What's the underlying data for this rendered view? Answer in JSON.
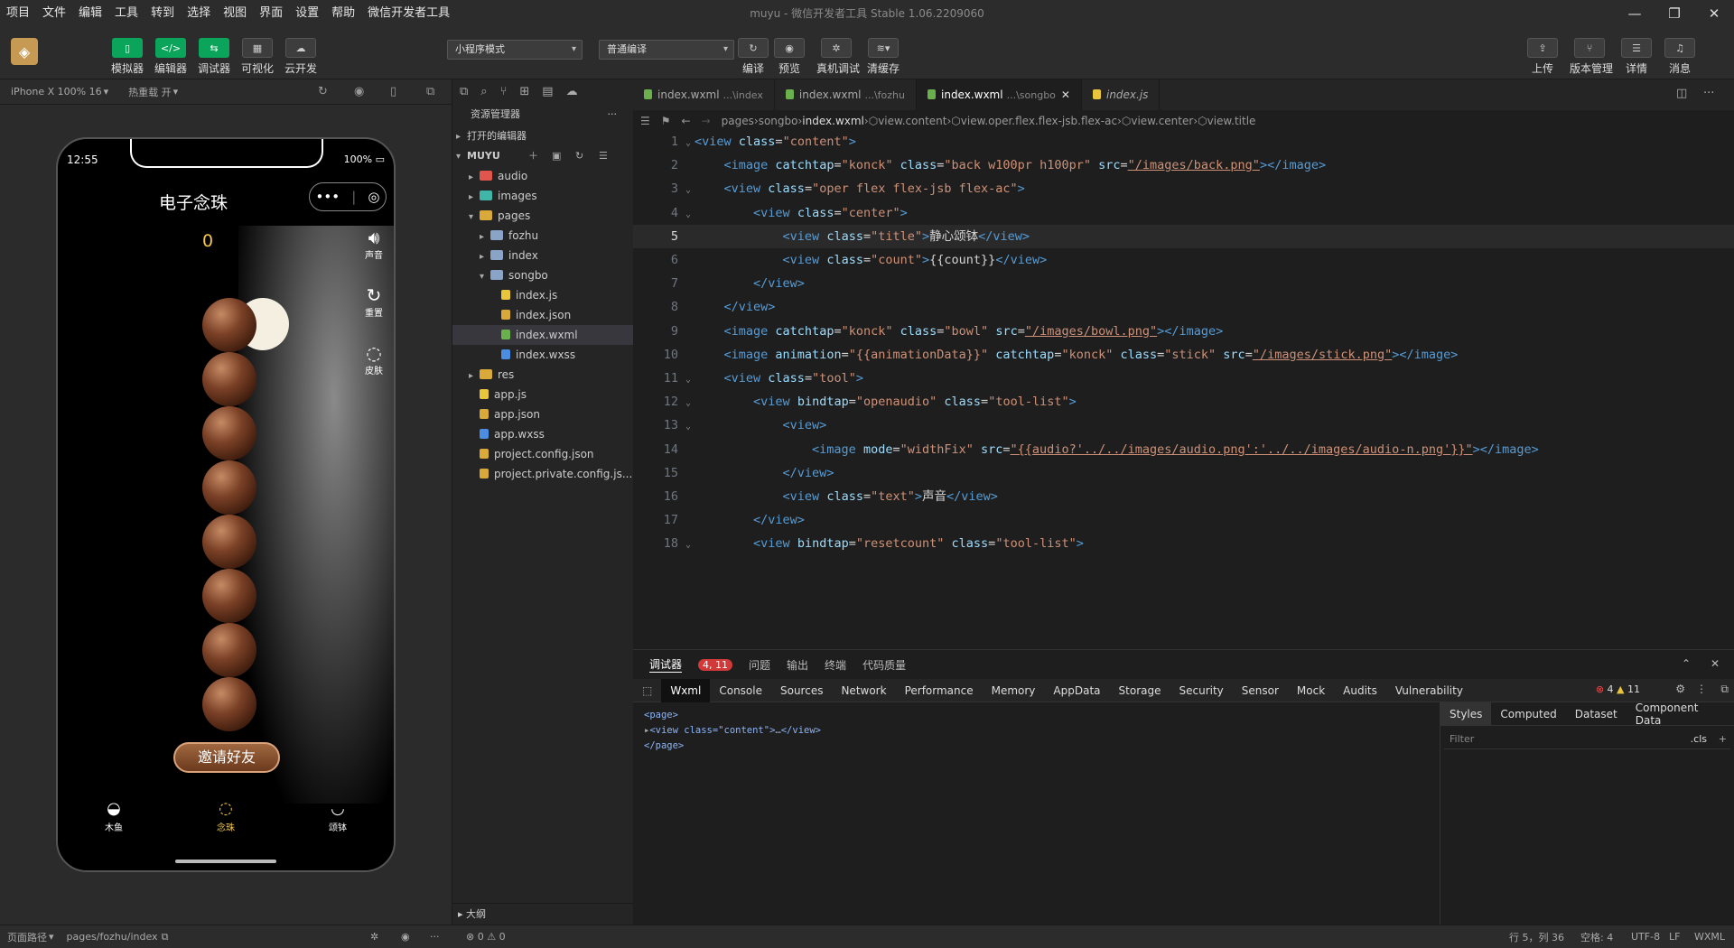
{
  "menu": [
    "项目",
    "文件",
    "编辑",
    "工具",
    "转到",
    "选择",
    "视图",
    "界面",
    "设置",
    "帮助",
    "微信开发者工具"
  ],
  "window_title": "muyu - 微信开发者工具 Stable 1.06.2209060",
  "toolbar": {
    "left_buttons": [
      "模拟器",
      "编辑器",
      "调试器",
      "可视化",
      "云开发"
    ],
    "mode_select": "小程序模式",
    "compile_select": "普通编译",
    "center_buttons": [
      "编译",
      "预览",
      "真机调试",
      "清缓存"
    ],
    "right_buttons": [
      "上传",
      "版本管理",
      "详情",
      "消息"
    ]
  },
  "simulator": {
    "device": "iPhone X 100% 16",
    "hot_reload": "热重载 开",
    "status_time": "12:55",
    "battery": "100%",
    "page_title": "电子念珠",
    "count": "0",
    "side_buttons": [
      "声音",
      "重置",
      "皮肤"
    ],
    "invite_label": "邀请好友",
    "tabbar": [
      "木鱼",
      "念珠",
      "颂钵"
    ],
    "tabbar_active": 1
  },
  "explorer": {
    "title": "资源管理器",
    "open_editors": "打开的编辑器",
    "project": "MUYU",
    "tree": [
      {
        "name": "audio",
        "type": "folder",
        "depth": 0,
        "color": "#e0564c"
      },
      {
        "name": "images",
        "type": "folder",
        "depth": 0,
        "color": "#3fb6a8"
      },
      {
        "name": "pages",
        "type": "folder-open",
        "depth": 0,
        "color": "#d9a93a"
      },
      {
        "name": "fozhu",
        "type": "folder",
        "depth": 1,
        "color": "#8aa4c8"
      },
      {
        "name": "index",
        "type": "folder",
        "depth": 1,
        "color": "#8aa4c8"
      },
      {
        "name": "songbo",
        "type": "folder-open",
        "depth": 1,
        "color": "#8aa4c8"
      },
      {
        "name": "index.js",
        "type": "js",
        "depth": 2,
        "color": "#e8c53a"
      },
      {
        "name": "index.json",
        "type": "json",
        "depth": 2,
        "color": "#d9a93a"
      },
      {
        "name": "index.wxml",
        "type": "wxml",
        "depth": 2,
        "color": "#6ab04c",
        "selected": true
      },
      {
        "name": "index.wxss",
        "type": "wxss",
        "depth": 2,
        "color": "#4b8de0"
      },
      {
        "name": "res",
        "type": "folder",
        "depth": 0,
        "color": "#d9a93a"
      },
      {
        "name": "app.js",
        "type": "js",
        "depth": 0,
        "color": "#e8c53a"
      },
      {
        "name": "app.json",
        "type": "json",
        "depth": 0,
        "color": "#d9a93a"
      },
      {
        "name": "app.wxss",
        "type": "wxss",
        "depth": 0,
        "color": "#4b8de0"
      },
      {
        "name": "project.config.json",
        "type": "json",
        "depth": 0,
        "color": "#d9a93a"
      },
      {
        "name": "project.private.config.js...",
        "type": "json",
        "depth": 0,
        "color": "#d9a93a"
      }
    ],
    "outline": "大纲"
  },
  "editor": {
    "tabs": [
      {
        "name": "index.wxml",
        "path": "...\\index",
        "active": false
      },
      {
        "name": "index.wxml",
        "path": "...\\fozhu",
        "active": false
      },
      {
        "name": "index.wxml",
        "path": "...\\songbo",
        "active": true
      },
      {
        "name": "index.js",
        "path": "",
        "active": false
      }
    ],
    "breadcrumb": [
      "pages",
      "songbo",
      "index.wxml",
      "view.content",
      "view.oper.flex.flex-jsb.flex-ac",
      "view.center",
      "view.title"
    ],
    "lines": [
      {
        "n": "1",
        "fold": true,
        "tokens": [
          [
            "#569cd6",
            "<view "
          ],
          [
            "#9cdcfe",
            "class"
          ],
          [
            "#d4d4d4",
            "="
          ],
          [
            "#ce9178",
            "\"content\""
          ],
          [
            "#569cd6",
            ">"
          ]
        ]
      },
      {
        "n": "2",
        "fold": false,
        "tokens": [
          [
            "#d4d4d4",
            "    "
          ],
          [
            "#569cd6",
            "<image "
          ],
          [
            "#9cdcfe",
            "catchtap"
          ],
          [
            "#d4d4d4",
            "="
          ],
          [
            "#ce9178",
            "\"konck\" "
          ],
          [
            "#9cdcfe",
            "class"
          ],
          [
            "#d4d4d4",
            "="
          ],
          [
            "#ce9178",
            "\"back w100pr h100pr\" "
          ],
          [
            "#9cdcfe",
            "src"
          ],
          [
            "#d4d4d4",
            "="
          ],
          [
            "#ce9178",
            "\"/images/back.png\""
          ],
          [
            "#569cd6",
            "></image>"
          ]
        ]
      },
      {
        "n": "3",
        "fold": true,
        "tokens": [
          [
            "#d4d4d4",
            "    "
          ],
          [
            "#569cd6",
            "<view "
          ],
          [
            "#9cdcfe",
            "class"
          ],
          [
            "#d4d4d4",
            "="
          ],
          [
            "#ce9178",
            "\"oper flex flex-jsb flex-ac\""
          ],
          [
            "#569cd6",
            ">"
          ]
        ]
      },
      {
        "n": "4",
        "fold": true,
        "tokens": [
          [
            "#d4d4d4",
            "        "
          ],
          [
            "#569cd6",
            "<view "
          ],
          [
            "#9cdcfe",
            "class"
          ],
          [
            "#d4d4d4",
            "="
          ],
          [
            "#ce9178",
            "\"center\""
          ],
          [
            "#569cd6",
            ">"
          ]
        ]
      },
      {
        "n": "5",
        "fold": false,
        "hl": true,
        "tokens": [
          [
            "#d4d4d4",
            "            "
          ],
          [
            "#569cd6",
            "<view "
          ],
          [
            "#9cdcfe",
            "class"
          ],
          [
            "#d4d4d4",
            "="
          ],
          [
            "#ce9178",
            "\"title\""
          ],
          [
            "#569cd6",
            ">"
          ],
          [
            "#d4d4d4",
            "静心颂钵"
          ],
          [
            "#569cd6",
            "</view>"
          ]
        ]
      },
      {
        "n": "6",
        "fold": false,
        "tokens": [
          [
            "#d4d4d4",
            "            "
          ],
          [
            "#569cd6",
            "<view "
          ],
          [
            "#9cdcfe",
            "class"
          ],
          [
            "#d4d4d4",
            "="
          ],
          [
            "#ce9178",
            "\"count\""
          ],
          [
            "#569cd6",
            ">"
          ],
          [
            "#d4d4d4",
            "{{count}}"
          ],
          [
            "#569cd6",
            "</view>"
          ]
        ]
      },
      {
        "n": "7",
        "fold": false,
        "tokens": [
          [
            "#d4d4d4",
            "        "
          ],
          [
            "#569cd6",
            "</view>"
          ]
        ]
      },
      {
        "n": "8",
        "fold": false,
        "tokens": [
          [
            "#d4d4d4",
            "    "
          ],
          [
            "#569cd6",
            "</view>"
          ]
        ]
      },
      {
        "n": "9",
        "fold": false,
        "tokens": [
          [
            "#d4d4d4",
            "    "
          ],
          [
            "#569cd6",
            "<image "
          ],
          [
            "#9cdcfe",
            "catchtap"
          ],
          [
            "#d4d4d4",
            "="
          ],
          [
            "#ce9178",
            "\"konck\" "
          ],
          [
            "#9cdcfe",
            "class"
          ],
          [
            "#d4d4d4",
            "="
          ],
          [
            "#ce9178",
            "\"bowl\" "
          ],
          [
            "#9cdcfe",
            "src"
          ],
          [
            "#d4d4d4",
            "="
          ],
          [
            "#ce9178",
            "\"/images/bowl.png\""
          ],
          [
            "#569cd6",
            "></image>"
          ]
        ]
      },
      {
        "n": "10",
        "fold": false,
        "tokens": [
          [
            "#d4d4d4",
            "    "
          ],
          [
            "#569cd6",
            "<image "
          ],
          [
            "#9cdcfe",
            "animation"
          ],
          [
            "#d4d4d4",
            "="
          ],
          [
            "#ce9178",
            "\"{{animationData}}\" "
          ],
          [
            "#9cdcfe",
            "catchtap"
          ],
          [
            "#d4d4d4",
            "="
          ],
          [
            "#ce9178",
            "\"konck\" "
          ],
          [
            "#9cdcfe",
            "class"
          ],
          [
            "#d4d4d4",
            "="
          ],
          [
            "#ce9178",
            "\"stick\" "
          ],
          [
            "#9cdcfe",
            "src"
          ],
          [
            "#d4d4d4",
            "="
          ],
          [
            "#ce9178",
            "\"/images/stick.png\""
          ],
          [
            "#569cd6",
            "></image>"
          ]
        ]
      },
      {
        "n": "11",
        "fold": true,
        "tokens": [
          [
            "#d4d4d4",
            "    "
          ],
          [
            "#569cd6",
            "<view "
          ],
          [
            "#9cdcfe",
            "class"
          ],
          [
            "#d4d4d4",
            "="
          ],
          [
            "#ce9178",
            "\"tool\""
          ],
          [
            "#569cd6",
            ">"
          ]
        ]
      },
      {
        "n": "12",
        "fold": true,
        "tokens": [
          [
            "#d4d4d4",
            "        "
          ],
          [
            "#569cd6",
            "<view "
          ],
          [
            "#9cdcfe",
            "bindtap"
          ],
          [
            "#d4d4d4",
            "="
          ],
          [
            "#ce9178",
            "\"openaudio\" "
          ],
          [
            "#9cdcfe",
            "class"
          ],
          [
            "#d4d4d4",
            "="
          ],
          [
            "#ce9178",
            "\"tool-list\""
          ],
          [
            "#569cd6",
            ">"
          ]
        ]
      },
      {
        "n": "13",
        "fold": true,
        "tokens": [
          [
            "#d4d4d4",
            "            "
          ],
          [
            "#569cd6",
            "<view>"
          ]
        ]
      },
      {
        "n": "14",
        "fold": false,
        "tokens": [
          [
            "#d4d4d4",
            "                "
          ],
          [
            "#569cd6",
            "<image "
          ],
          [
            "#9cdcfe",
            "mode"
          ],
          [
            "#d4d4d4",
            "="
          ],
          [
            "#ce9178",
            "\"widthFix\" "
          ],
          [
            "#9cdcfe",
            "src"
          ],
          [
            "#d4d4d4",
            "="
          ],
          [
            "#ce9178",
            "\"{{audio?'../../images/audio.png':'../../images/audio-n.png'}}\""
          ],
          [
            "#569cd6",
            "></image>"
          ]
        ]
      },
      {
        "n": "15",
        "fold": false,
        "tokens": [
          [
            "#d4d4d4",
            "            "
          ],
          [
            "#569cd6",
            "</view>"
          ]
        ]
      },
      {
        "n": "16",
        "fold": false,
        "tokens": [
          [
            "#d4d4d4",
            "            "
          ],
          [
            "#569cd6",
            "<view "
          ],
          [
            "#9cdcfe",
            "class"
          ],
          [
            "#d4d4d4",
            "="
          ],
          [
            "#ce9178",
            "\"text\""
          ],
          [
            "#569cd6",
            ">"
          ],
          [
            "#d4d4d4",
            "声音"
          ],
          [
            "#569cd6",
            "</view>"
          ]
        ]
      },
      {
        "n": "17",
        "fold": false,
        "tokens": [
          [
            "#d4d4d4",
            "        "
          ],
          [
            "#569cd6",
            "</view>"
          ]
        ]
      },
      {
        "n": "18",
        "fold": true,
        "tokens": [
          [
            "#d4d4d4",
            "        "
          ],
          [
            "#569cd6",
            "<view "
          ],
          [
            "#9cdcfe",
            "bindtap"
          ],
          [
            "#d4d4d4",
            "="
          ],
          [
            "#ce9178",
            "\"resetcount\" "
          ],
          [
            "#9cdcfe",
            "class"
          ],
          [
            "#d4d4d4",
            "="
          ],
          [
            "#ce9178",
            "\"tool-list\""
          ],
          [
            "#569cd6",
            ">"
          ]
        ]
      }
    ]
  },
  "panel": {
    "tabs": [
      "调试器",
      "问题",
      "输出",
      "终端",
      "代码质量"
    ],
    "badge": "4, 11",
    "devtools_tabs": [
      "Wxml",
      "Console",
      "Sources",
      "Network",
      "Performance",
      "Memory",
      "AppData",
      "Storage",
      "Security",
      "Sensor",
      "Mock",
      "Audits",
      "Vulnerability"
    ],
    "errors": "4",
    "warnings": "11",
    "dom_lines": [
      "<page>",
      "<view class=\"content\">…</view>",
      "</page>"
    ],
    "style_tabs": [
      "Styles",
      "Computed",
      "Dataset",
      "Component Data"
    ],
    "filter_placeholder": "Filter",
    "cls": ".cls"
  },
  "statusbar": {
    "path_label": "页面路径",
    "path": "pages/fozhu/index",
    "problems": "⊗ 0 ⚠ 0",
    "cursor": "行 5，列 36",
    "spaces": "空格: 4",
    "encoding": "UTF-8",
    "eol": "LF",
    "lang": "WXML"
  }
}
